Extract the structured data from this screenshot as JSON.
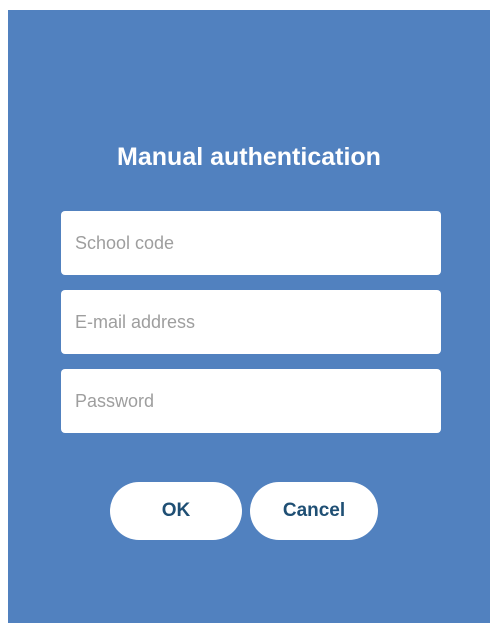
{
  "dialog": {
    "title": "Manual authentication",
    "fields": {
      "school_code": {
        "placeholder": "School code",
        "value": ""
      },
      "email": {
        "placeholder": "E-mail address",
        "value": ""
      },
      "password": {
        "placeholder": "Password",
        "value": ""
      }
    },
    "buttons": {
      "ok_label": "OK",
      "cancel_label": "Cancel"
    }
  },
  "colors": {
    "background": "#5181bf",
    "button_text": "#1f4f74",
    "placeholder": "#9e9e9e"
  }
}
